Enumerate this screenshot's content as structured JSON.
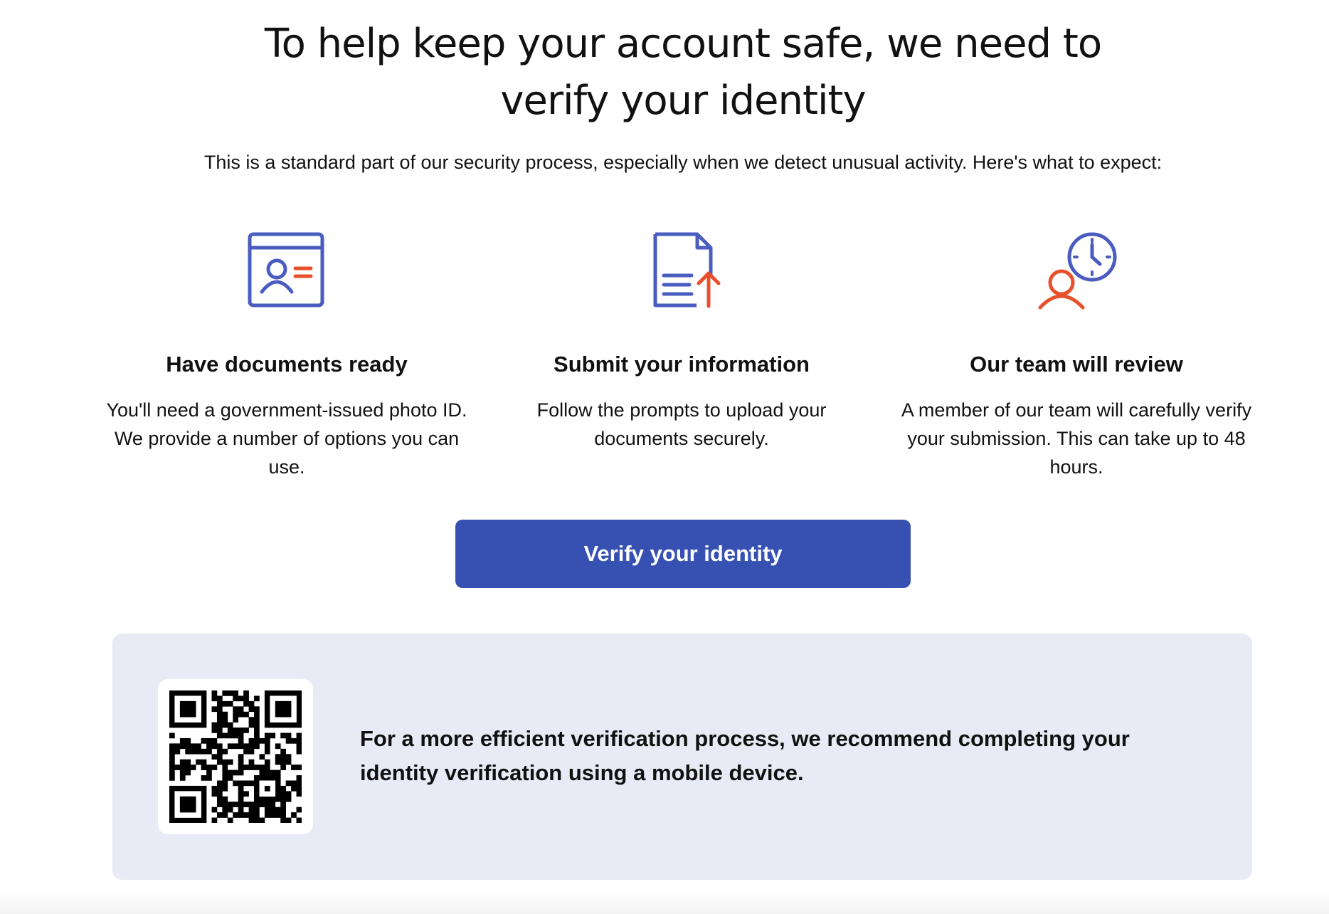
{
  "header": {
    "title": "To help keep your account safe, we need to verify your identity",
    "subtitle": "This is a standard part of our security process, especially when we detect unusual activity. Here's what to expect:"
  },
  "steps": [
    {
      "icon": "id-card-icon",
      "heading": "Have documents ready",
      "text": "You'll need a government-issued photo ID. We provide a number of options you can use."
    },
    {
      "icon": "document-upload-icon",
      "heading": "Submit your information",
      "text": "Follow the prompts to upload your documents securely."
    },
    {
      "icon": "person-clock-icon",
      "heading": "Our team will review",
      "text": "A member of our team will carefully verify your submission. This can take up to 48 hours."
    }
  ],
  "verify_button": {
    "label": "Verify your identity"
  },
  "mobile": {
    "qr_icon": "qr-code-icon",
    "text": "For a more efficient verification process, we recommend completing your identity verification using a mobile device."
  },
  "colors": {
    "primary": "#3751b3",
    "icon_blue": "#4a5cc0",
    "icon_orange": "#e8502b",
    "panel_background": "#e8eaf5",
    "text": "#111111"
  }
}
